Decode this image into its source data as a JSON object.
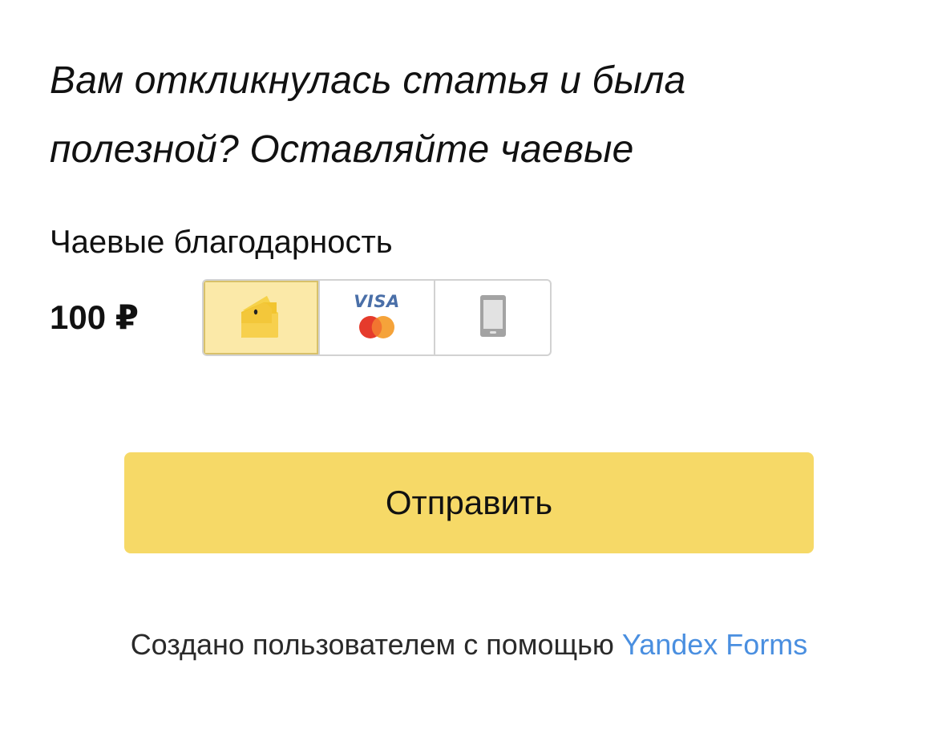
{
  "heading": {
    "line1": "Вам откликнулась статья и была",
    "line2": "полезной? Оставляйте чаевые"
  },
  "field": {
    "label": "Чаевые благодарность",
    "amount": "100 ₽"
  },
  "payment_methods": [
    {
      "id": "wallet",
      "icon": "yoomoney-wallet-icon",
      "selected": true
    },
    {
      "id": "card",
      "icon": "visa-mastercard-icon",
      "visa_text": "VISA",
      "selected": false
    },
    {
      "id": "mobile",
      "icon": "mobile-phone-icon",
      "selected": false
    }
  ],
  "submit": {
    "label": "Отправить"
  },
  "footer": {
    "text": "Создано пользователем с помощью ",
    "link": "Yandex Forms"
  },
  "colors": {
    "button_bg": "#f6d967",
    "selected_bg": "#fbe9a8",
    "link": "#4a8fe0",
    "visa": "#4a6fa8"
  }
}
